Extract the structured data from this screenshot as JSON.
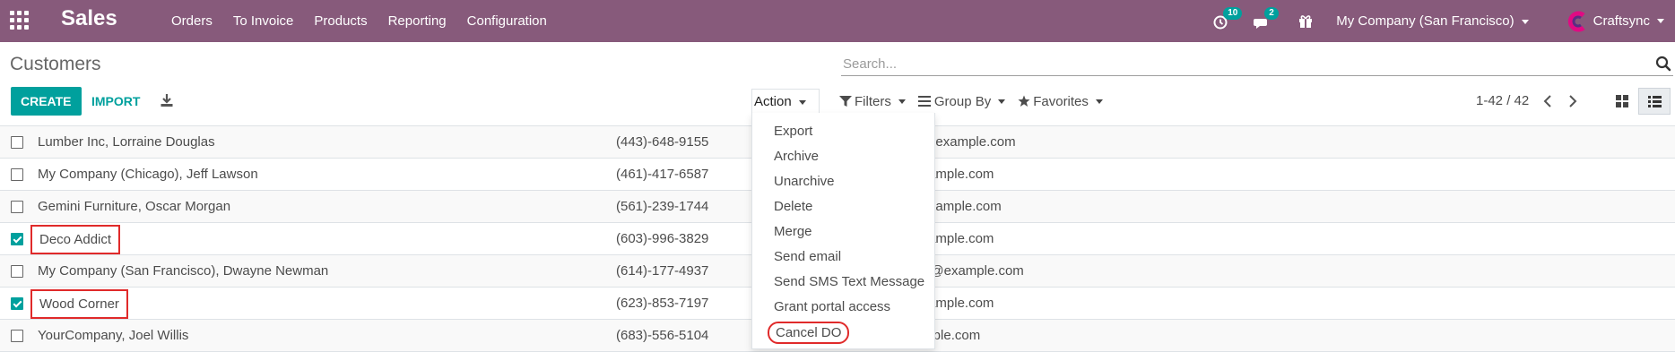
{
  "navbar": {
    "app_title": "Sales",
    "menu": [
      "Orders",
      "To Invoice",
      "Products",
      "Reporting",
      "Configuration"
    ],
    "activity_count": "10",
    "messages_count": "2",
    "company": "My Company (San Francisco)",
    "user": "Craftsync",
    "bg_color": "#875a7b"
  },
  "breadcrumb": "Customers",
  "search": {
    "placeholder": "Search..."
  },
  "buttons": {
    "create": "CREATE",
    "import": "IMPORT"
  },
  "action": {
    "label": "Action"
  },
  "filters": {
    "filters": "Filters",
    "group_by": "Group By",
    "favorites": "Favorites"
  },
  "pager": {
    "range": "1-42 / 42"
  },
  "rows": [
    {
      "name": "Lumber Inc, Lorraine Douglas",
      "phone": "(443)-648-9155",
      "email": "s35@example.com",
      "checked": false
    },
    {
      "name": "My Company (Chicago), Jeff Lawson",
      "phone": "(461)-417-6587",
      "email": "@example.com",
      "checked": false
    },
    {
      "name": "Gemini Furniture, Oscar Morgan",
      "phone": "(561)-239-1744",
      "email": "1@example.com",
      "checked": false
    },
    {
      "name": "Deco Addict",
      "phone": "(603)-996-3829",
      "email": "@example.com",
      "checked": true
    },
    {
      "name": "My Company (San Francisco), Dwayne Newman",
      "phone": "(614)-177-4937",
      "email": "an28@example.com",
      "checked": false
    },
    {
      "name": "Wood Corner",
      "phone": "(623)-853-7197",
      "email": "@example.com",
      "checked": true
    },
    {
      "name": "YourCompany, Joel Willis",
      "phone": "(683)-556-5104",
      "email": "example.com",
      "checked": false
    }
  ],
  "action_menu": [
    "Export",
    "Archive",
    "Unarchive",
    "Delete",
    "Merge",
    "Send email",
    "Send SMS Text Message",
    "Grant portal access",
    "Cancel DO"
  ],
  "colors": {
    "accent": "#00a09d",
    "highlight": "#e02a2a"
  }
}
